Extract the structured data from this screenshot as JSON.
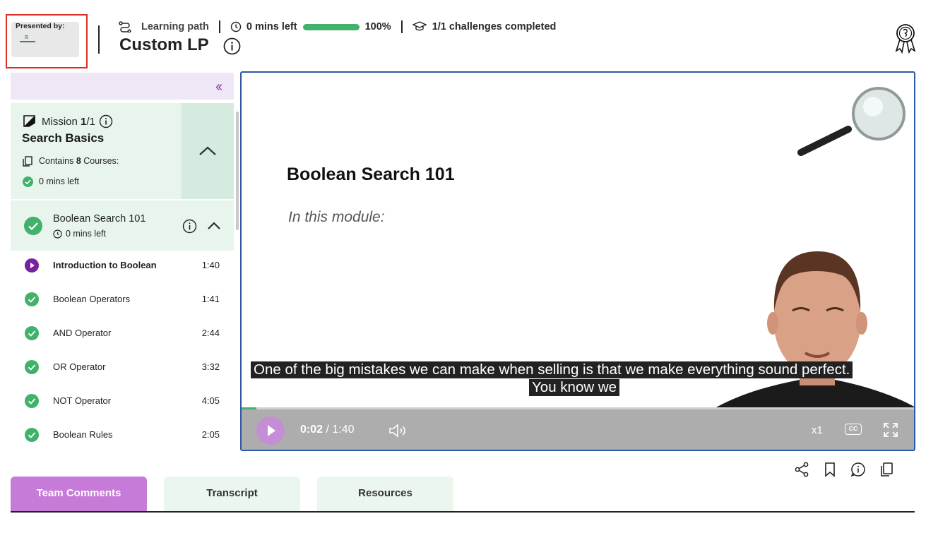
{
  "header": {
    "presented_by": "Presented by:",
    "learning_path_label": "Learning path",
    "time_left": "0 mins left",
    "progress_percent": "100%",
    "progress_fraction": 1.0,
    "challenges": "1/1 challenges completed",
    "title": "Custom LP"
  },
  "sidebar": {
    "mission": {
      "label": "Mission ",
      "index": "1",
      "total": "/1",
      "name": "Search Basics",
      "contains_prefix": "Contains ",
      "course_count": "8",
      "contains_suffix": " Courses:",
      "time_left": "0 mins left"
    },
    "course": {
      "name": "Boolean Search 101",
      "time_left": "0 mins left"
    },
    "lessons": [
      {
        "name": "Introduction to Boolean",
        "duration": "1:40",
        "status": "playing"
      },
      {
        "name": "Boolean Operators",
        "duration": "1:41",
        "status": "completed"
      },
      {
        "name": "AND Operator",
        "duration": "2:44",
        "status": "completed"
      },
      {
        "name": "OR Operator",
        "duration": "3:32",
        "status": "completed"
      },
      {
        "name": "NOT Operator",
        "duration": "4:05",
        "status": "completed"
      },
      {
        "name": "Boolean Rules",
        "duration": "2:05",
        "status": "completed"
      }
    ]
  },
  "player": {
    "slide_title": "Boolean Search 101",
    "slide_subtitle": "In this module:",
    "caption_line1": "One of the big mistakes we can make when selling is that we make everything sound perfect.",
    "caption_line2": "You know we",
    "current_time": "0:02",
    "time_separator": " / ",
    "duration": "1:40",
    "speed": "x1",
    "cc_label": "CC",
    "seek_fraction": 0.02
  },
  "tabs": [
    {
      "label": "Team Comments",
      "active": true
    },
    {
      "label": "Transcript",
      "active": false
    },
    {
      "label": "Resources",
      "active": false
    }
  ],
  "colors": {
    "accent_purple": "#8a3fc1",
    "tab_active": "#c77bd8",
    "success_green": "#41b16b",
    "mission_bg": "#e8f5ec",
    "player_border": "#2d57a8"
  },
  "icons": [
    "learning-path-icon",
    "clock-icon",
    "graduation-cap-icon",
    "info-icon",
    "award-ribbon-icon",
    "collapse-double-chevron-icon",
    "mission-flag-icon",
    "courses-stack-icon",
    "check-circle-icon",
    "chevron-up-icon",
    "play-icon",
    "volume-icon",
    "cc-icon",
    "fullscreen-icon",
    "share-icon",
    "bookmark-icon",
    "copy-icon"
  ]
}
